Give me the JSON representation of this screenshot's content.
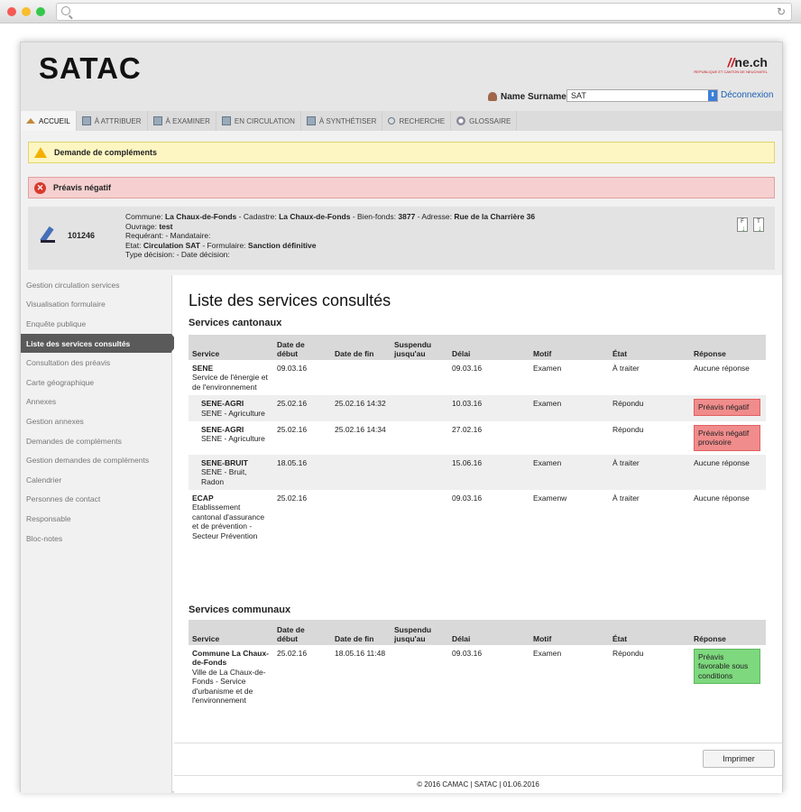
{
  "browser": {
    "reload_icon": "reload-icon"
  },
  "header": {
    "logo": "SATAC",
    "brand": "ne.ch",
    "brand_sub": "REPUBLIQUE ET CANTON DE NEUCHATEL",
    "user_name": "Name Surname",
    "role": "SAT",
    "logout": "Déconnexion"
  },
  "tabs": [
    {
      "label": "ACCUEIL",
      "icon": "home-icon"
    },
    {
      "label": "À ATTRIBUER",
      "icon": "document-icon"
    },
    {
      "label": "À EXAMINER",
      "icon": "document-icon"
    },
    {
      "label": "EN CIRCULATION",
      "icon": "document-icon"
    },
    {
      "label": "À SYNTHÉTISER",
      "icon": "document-icon"
    },
    {
      "label": "RECHERCHE",
      "icon": "search-icon"
    },
    {
      "label": "GLOSSAIRE",
      "icon": "gear-icon"
    }
  ],
  "alerts": {
    "complements": "Demande de compléments",
    "negative": "Préavis négatif"
  },
  "dossier": {
    "number": "101246",
    "l_commune": "Commune:",
    "commune": "La Chaux-de-Fonds",
    "l_cadastre": "- Cadastre:",
    "cadastre": "La Chaux-de-Fonds",
    "l_bienfonds": "- Bien-fonds:",
    "bienfonds": "3877",
    "l_adresse": "- Adresse:",
    "adresse": "Rue de la Charrière 36",
    "l_ouvrage": "Ouvrage:",
    "ouvrage": "test",
    "requerant": "Requérant: - Mandataire:",
    "l_etat": "Etat:",
    "etat": "Circulation SAT",
    "l_formulaire": "- Formulaire:",
    "formulaire": "Sanction définitive",
    "type": "Type décision: - Date décision:",
    "icon_f": "F",
    "icon_t": "T"
  },
  "sidebar": {
    "items": [
      "Gestion circulation services",
      "Visualisation formulaire",
      "Enquête publique",
      "Liste des services consultés",
      "Consultation des préavis",
      "Carte géographique",
      "Annexes",
      "Gestion annexes",
      "Demandes de compléments",
      "Gestion demandes de compléments",
      "Calendrier",
      "Personnes de contact",
      "Responsable",
      "Bloc-notes"
    ]
  },
  "main": {
    "title": "Liste des services consultés",
    "cantonal_title": "Services cantonaux",
    "communal_title": "Services communaux",
    "columns": [
      "Service",
      "Date de début",
      "Date de fin",
      "Suspendu jusqu'au",
      "Délai",
      "Motif",
      "État",
      "Réponse"
    ],
    "cantonal_rows": [
      {
        "code": "SENE",
        "desc": "Service de l'énergie et de l'environnement",
        "start": "09.03.16",
        "end": "",
        "suspended": "",
        "delay": "09.03.16",
        "motif": "Examen",
        "state": "À traiter",
        "response": "Aucune réponse"
      },
      {
        "code": "SENE-AGRI",
        "desc": "SENE - Agriculture",
        "start": "25.02.16",
        "end": "25.02.16 14:32",
        "suspended": "",
        "delay": "10.03.16",
        "motif": "Examen",
        "state": "Répondu",
        "response": "Préavis négatif"
      },
      {
        "code": "SENE-AGRI",
        "desc": "SENE - Agriculture",
        "start": "25.02.16",
        "end": "25.02.16 14:34",
        "suspended": "",
        "delay": "27.02.16",
        "motif": "",
        "state": "Répondu",
        "response": "Préavis négatif provisoire"
      },
      {
        "code": "SENE-BRUIT",
        "desc": "SENE - Bruit, Radon",
        "start": "18.05.16",
        "end": "",
        "suspended": "",
        "delay": "15.06.16",
        "motif": "Examen",
        "state": "À traiter",
        "response": "Aucune réponse"
      },
      {
        "code": "ECAP",
        "desc": "Etablissement cantonal d'assurance et de prévention - Secteur Prévention",
        "start": "25.02.16",
        "end": "",
        "suspended": "",
        "delay": "09.03.16",
        "motif": "Examenw",
        "state": "À traiter",
        "response": "Aucune réponse"
      }
    ],
    "communal_rows": [
      {
        "code": "Commune La Chaux-de-Fonds",
        "desc": "Ville de La Chaux-de-Fonds - Service d'urbanisme et de l'environnement",
        "start": "25.02.16",
        "end": "18.05.16 11:48",
        "suspended": "",
        "delay": "09.03.16",
        "motif": "Examen",
        "state": "Répondu",
        "response": "Préavis favorable sous conditions"
      }
    ],
    "print": "Imprimer"
  },
  "footer": "© 2016 CAMAC | SATAC | 01.06.2016"
}
